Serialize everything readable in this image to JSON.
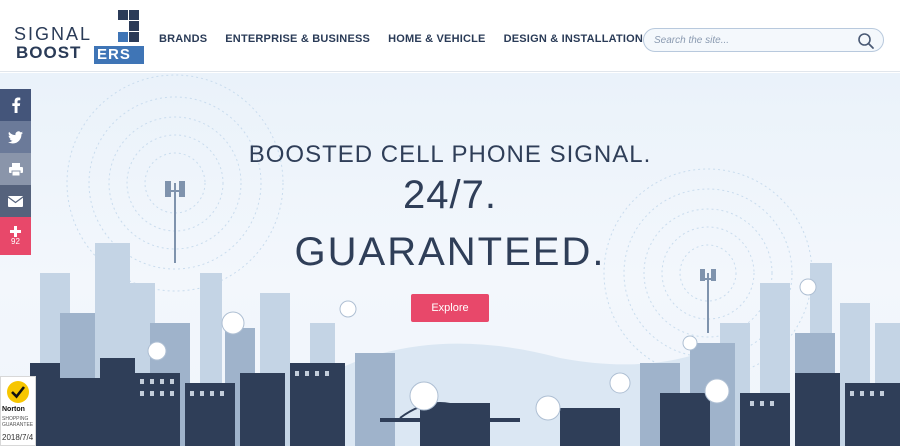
{
  "logo": {
    "top": "SIGNAL",
    "bottom": "BOOST",
    "badge": "ERS"
  },
  "nav": [
    {
      "label": "BRANDS"
    },
    {
      "label": "ENTERPRISE & BUSINESS"
    },
    {
      "label": "HOME & VEHICLE"
    },
    {
      "label": "DESIGN & INSTALLATION"
    }
  ],
  "search": {
    "placeholder": "Search the site..."
  },
  "hero": {
    "line1": "BOOSTED CELL PHONE SIGNAL.",
    "line2": "24/7.",
    "line3": "GUARANTEED.",
    "cta": "Explore"
  },
  "social": {
    "icons": [
      "facebook-icon",
      "twitter-icon",
      "print-icon",
      "email-icon",
      "plus-icon"
    ],
    "share_count": "92"
  },
  "norton": {
    "brand": "Norton",
    "line1": "SHOPPING",
    "line2": "GUARANTEE",
    "date": "2018/7/4"
  },
  "colors": {
    "navy": "#2a3b57",
    "accent": "#e8486a",
    "brand_blue": "#3f75b6"
  }
}
